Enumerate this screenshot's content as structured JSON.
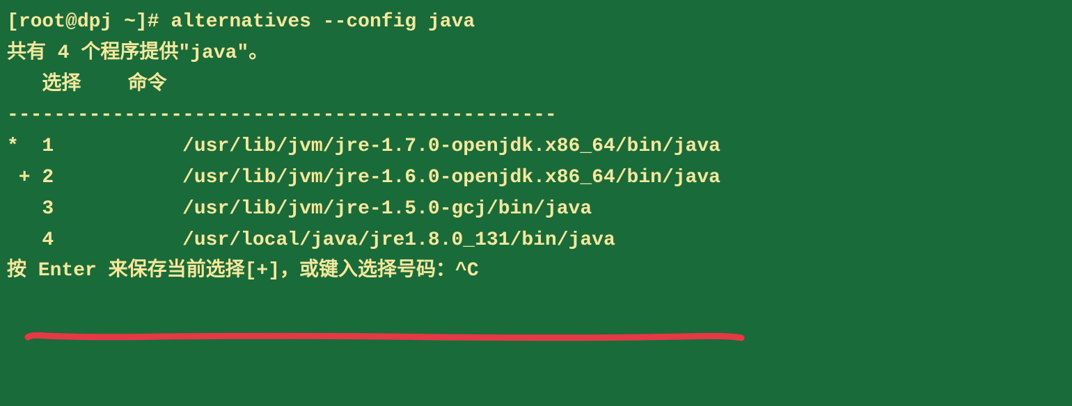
{
  "prompt": {
    "user": "root",
    "host": "dpj",
    "path": "~",
    "symbol": "#",
    "command": "alternatives --config java"
  },
  "blank1": "",
  "summary": "共有 4 个程序提供\"java\"。",
  "blank2": "",
  "header": {
    "selection": "   选择    命令",
    "divider": "-----------------------------------------------"
  },
  "alternatives": [
    {
      "mark": "*  1           /usr/lib/jvm/jre-1.7.0-openjdk.x86_64/bin/java"
    },
    {
      "mark": " + 2           /usr/lib/jvm/jre-1.6.0-openjdk.x86_64/bin/java"
    },
    {
      "mark": "   3           /usr/lib/jvm/jre-1.5.0-gcj/bin/java"
    },
    {
      "mark": "   4           /usr/local/java/jre1.8.0_131/bin/java"
    }
  ],
  "blank3": "",
  "footer": "按 Enter 来保存当前选择[+]，或键入选择号码：^C",
  "annotation": {
    "color": "#e63946"
  }
}
